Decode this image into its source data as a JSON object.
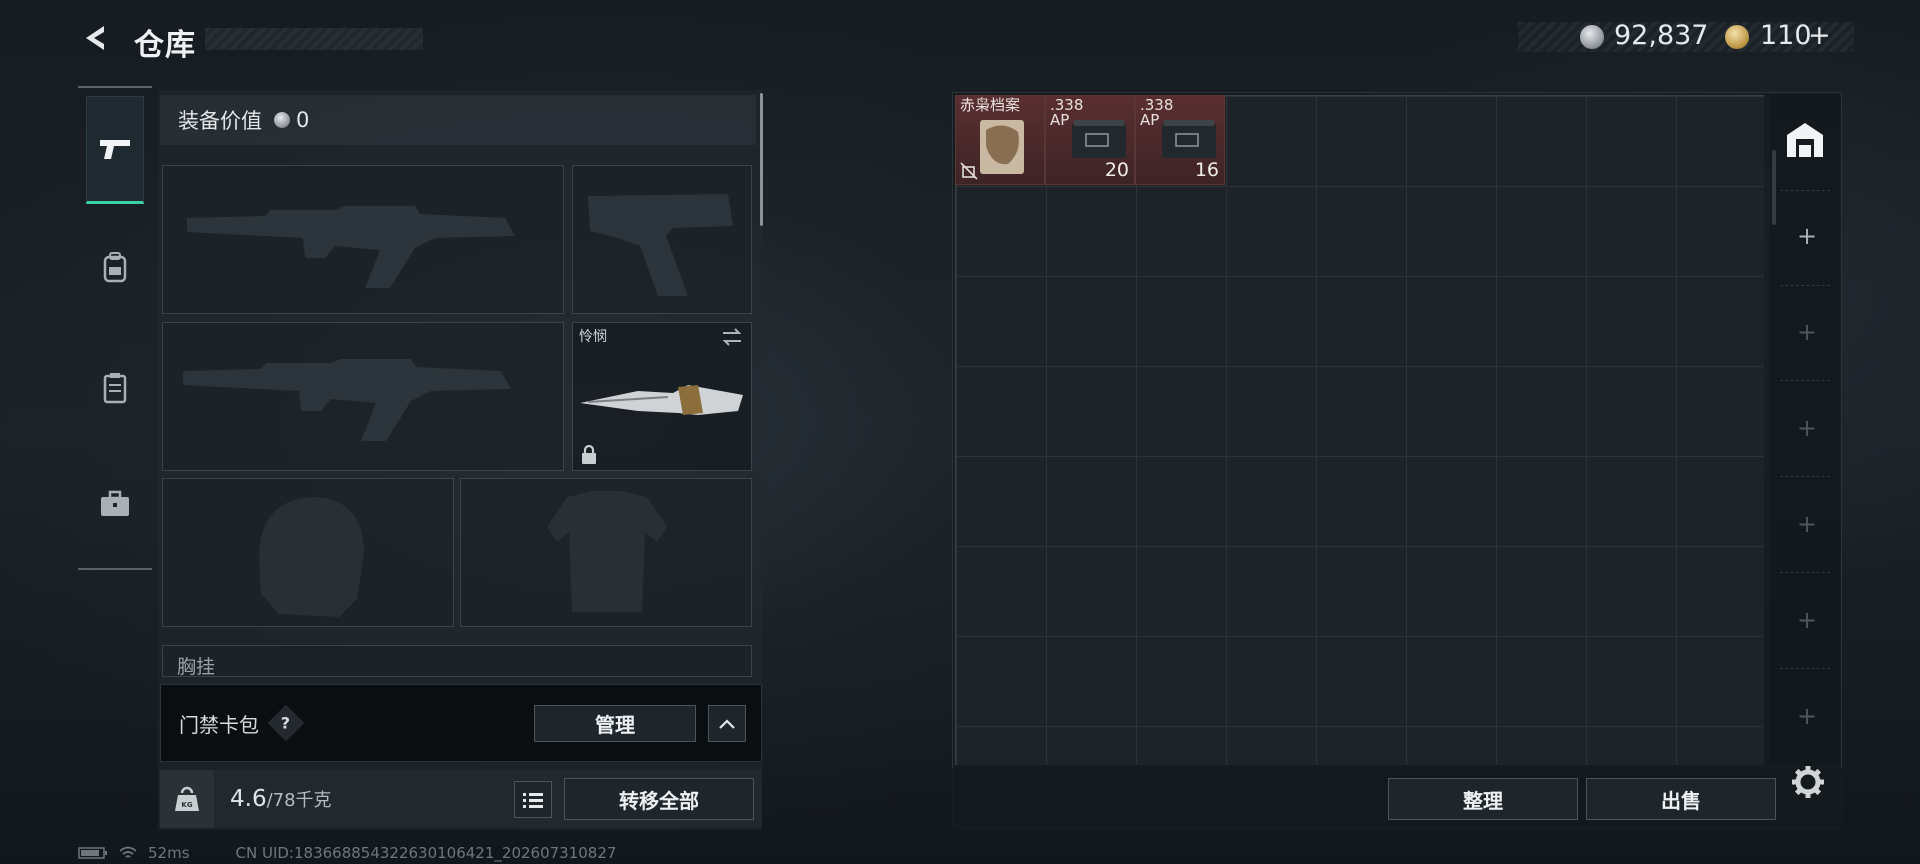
{
  "header": {
    "title": "仓库"
  },
  "currency": {
    "silver": "92,837",
    "gold": "110",
    "gold_plus": "+"
  },
  "equipment": {
    "value_label": "装备价值",
    "value": "0",
    "melee_name": "怜悯",
    "chest_label": "胸挂"
  },
  "access": {
    "label": "门禁卡包",
    "help": "?",
    "manage_label": "管理"
  },
  "weight": {
    "current": "4.6",
    "max": "/78千克"
  },
  "transfer_all_label": "转移全部",
  "stash": {
    "items": [
      {
        "label": "赤枭档案",
        "count": ""
      },
      {
        "label": ".338\nAP",
        "count": "20"
      },
      {
        "label": ".338\nAP",
        "count": "16"
      }
    ],
    "sort_label": "整理",
    "sell_label": "出售"
  },
  "status": {
    "ping": "52ms",
    "uid": "CN UID:183668854322630106421_202607310827"
  },
  "colors": {
    "accent_green": "#3dd1a6",
    "item_red": "#5a2f31"
  }
}
